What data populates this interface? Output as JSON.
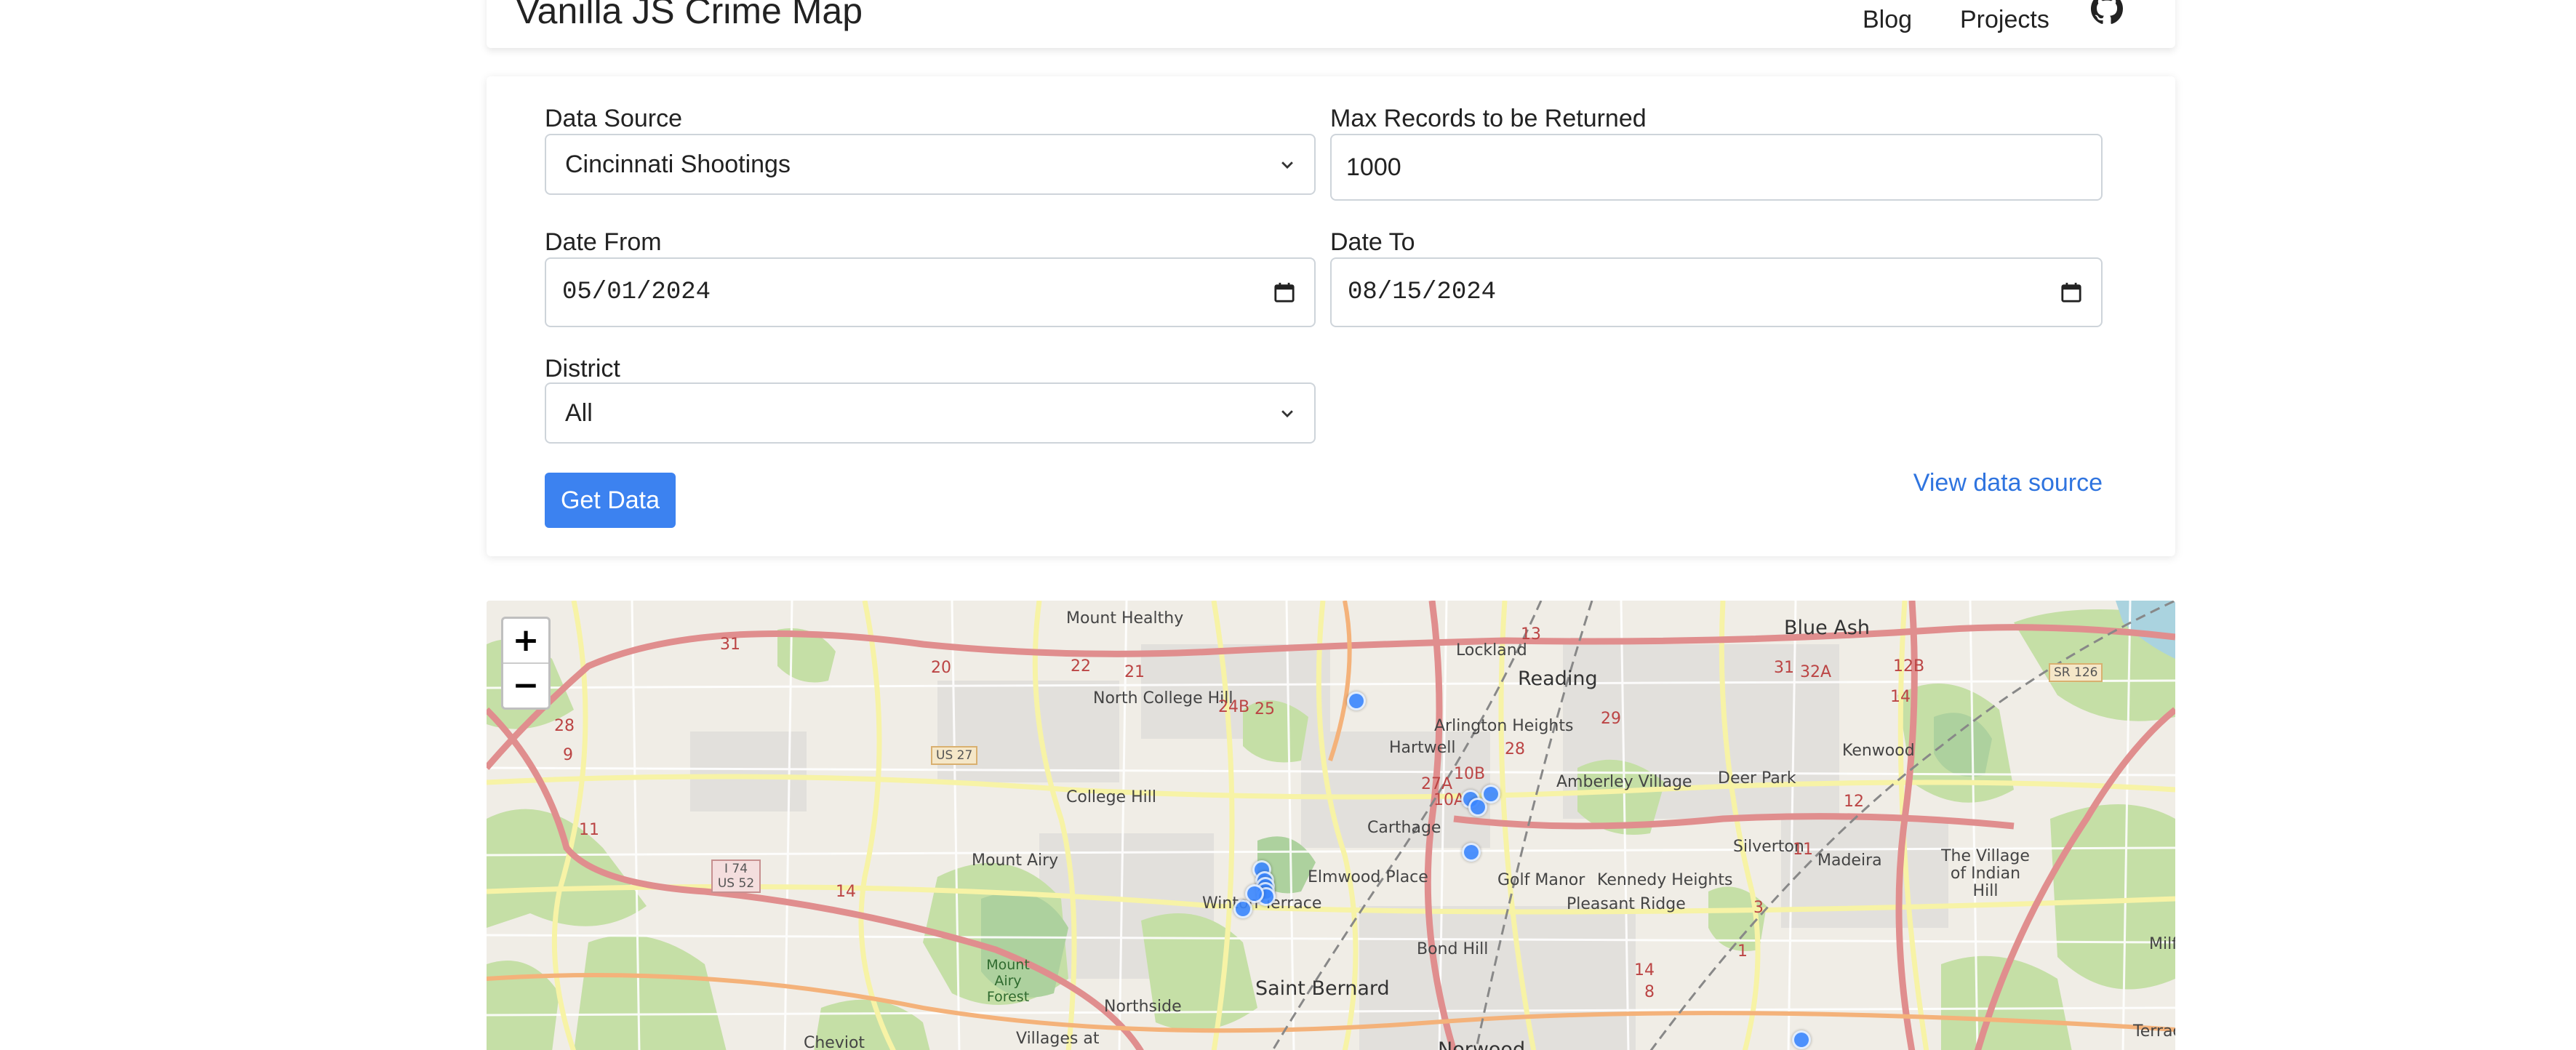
{
  "nav": {
    "brand": "Vanilla JS Crime Map",
    "links": [
      "Blog",
      "Projects"
    ],
    "github_icon": "github-icon"
  },
  "form": {
    "data_source_label": "Data Source",
    "data_source_value": "Cincinnati Shootings",
    "max_records_label": "Max Records to be Returned",
    "max_records_value": "1000",
    "date_from_label": "Date From",
    "date_from_value": "05/01/2024",
    "date_to_label": "Date To",
    "date_to_value": "08/15/2024",
    "district_label": "District",
    "district_value": "All",
    "submit_label": "Get Data",
    "view_source_label": "View data source",
    "accent_color": "#3c82f0",
    "link_color": "#2f74df"
  },
  "map": {
    "zoom_in": "+",
    "zoom_out": "−",
    "places": [
      "Mount Healthy",
      "North College Hill",
      "College Hill",
      "Mount Airy",
      "Lockland",
      "Reading",
      "Arlington Heights",
      "Hartwell",
      "Amberley Village",
      "Deer Park",
      "Blue Ash",
      "Kenwood",
      "Carthage",
      "Elmwood Place",
      "Golf Manor",
      "Kennedy Heights",
      "Silverton",
      "Madeira",
      "The Village of Indian Hill",
      "Pleasant Ridge",
      "Winton Terrace",
      "Bond Hill",
      "Saint Bernard",
      "Northside",
      "Cheviot",
      "Villages at",
      "Norwood",
      "Terrace Park",
      "Milf"
    ],
    "parks": [
      "Mount Airy Forest"
    ],
    "shields": [
      "US 27",
      "I 74 US 52",
      "SR 126"
    ],
    "route_numbers": [
      "31",
      "28",
      "9",
      "11",
      "20",
      "22",
      "21",
      "24B",
      "25",
      "31",
      "32A",
      "14",
      "12B",
      "13",
      "29",
      "28",
      "27A",
      "10B",
      "10A",
      "14",
      "11",
      "12",
      "3",
      "1",
      "14",
      "8"
    ],
    "marker_color": "#3a86ff",
    "marker_count": 14
  }
}
